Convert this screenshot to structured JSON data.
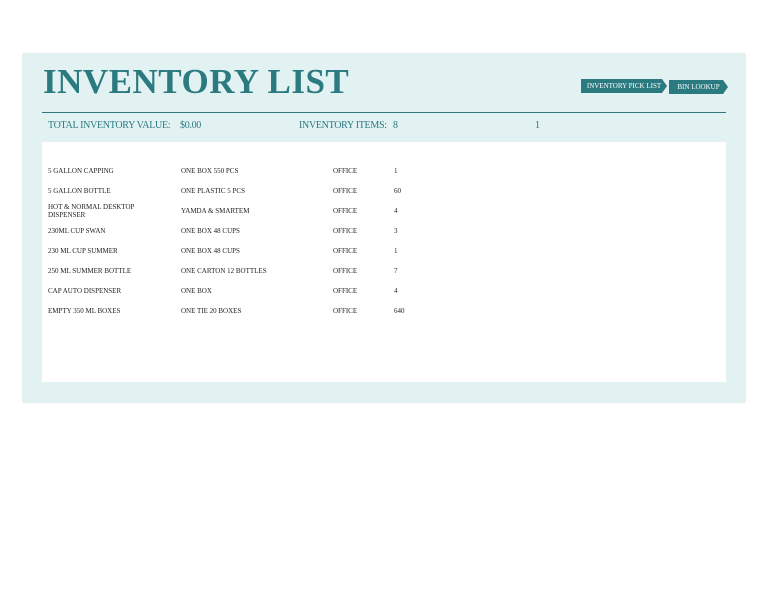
{
  "title": "INVENTORY LIST",
  "buttons": {
    "pick_list": "INVENTORY PICK LIST",
    "bin_lookup": "BIN LOOKUP"
  },
  "summary": {
    "total_value_label": "TOTAL INVENTORY VALUE:",
    "total_value": "$0.00",
    "items_label": "INVENTORY ITEMS:",
    "items_count": "8",
    "extra_value": "1"
  },
  "rows": [
    {
      "description": "5 GALLON CAPPING",
      "unit": "ONE BOX 550 PCS",
      "location": "OFFICE",
      "quantity": "1"
    },
    {
      "description": "5 GALLON BOTTLE",
      "unit": "ONE PLASTIC 5 PCS",
      "location": "OFFICE",
      "quantity": "60"
    },
    {
      "description": "HOT & NORMAL DESKTOP DISPENSER",
      "unit": "YAMDA & SMARTEM",
      "location": "OFFICE",
      "quantity": "4"
    },
    {
      "description": "230ML CUP  SWAN",
      "unit": "ONE BOX 48 CUPS",
      "location": "OFFICE",
      "quantity": "3"
    },
    {
      "description": "230 ML CUP SUMMER",
      "unit": "ONE BOX 48 CUPS",
      "location": "OFFICE",
      "quantity": "1"
    },
    {
      "description": "250 ML SUMMER BOTTLE",
      "unit": "ONE CARTON 12 BOTTLES",
      "location": "OFFICE",
      "quantity": "7"
    },
    {
      "description": "CAP AUTO DISPENSER",
      "unit": "ONE BOX",
      "location": "OFFICE",
      "quantity": "4"
    },
    {
      "description": "EMPTY 350 ML BOXES",
      "unit": "ONE TIE 20 BOXES",
      "location": "OFFICE",
      "quantity": "640"
    }
  ],
  "colors": {
    "accent": "#2b7a80",
    "panel_background": "#e2f2f3",
    "table_background": "#ffffff"
  }
}
